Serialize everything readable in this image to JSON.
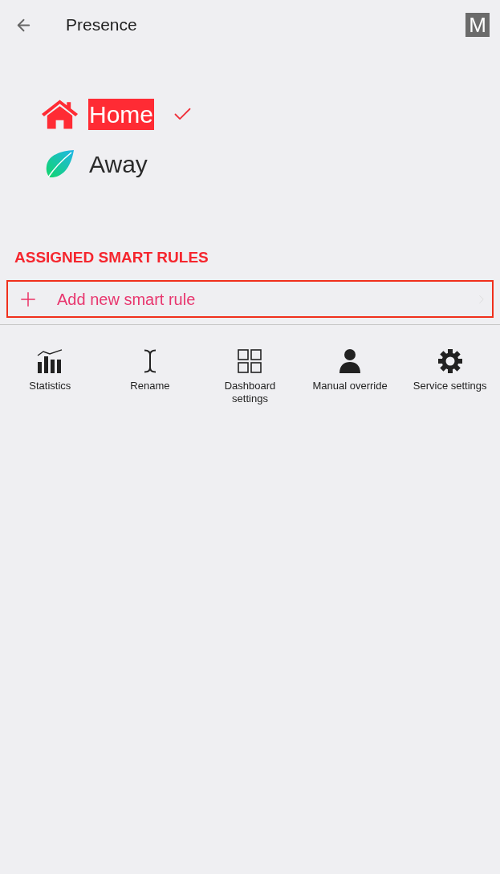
{
  "header": {
    "title": "Presence",
    "badge": "M"
  },
  "modes": [
    {
      "kind": "home",
      "label": "Home",
      "selected": true
    },
    {
      "kind": "away",
      "label": "Away",
      "selected": false
    }
  ],
  "rules": {
    "heading": "ASSIGNED SMART RULES",
    "add_label": "Add new smart rule"
  },
  "actions": [
    {
      "kind": "statistics",
      "label": "Statistics"
    },
    {
      "kind": "rename",
      "label": "Rename"
    },
    {
      "kind": "dashboard",
      "label": "Dashboard settings"
    },
    {
      "kind": "override",
      "label": "Manual override"
    },
    {
      "kind": "service",
      "label": "Service settings"
    }
  ]
}
